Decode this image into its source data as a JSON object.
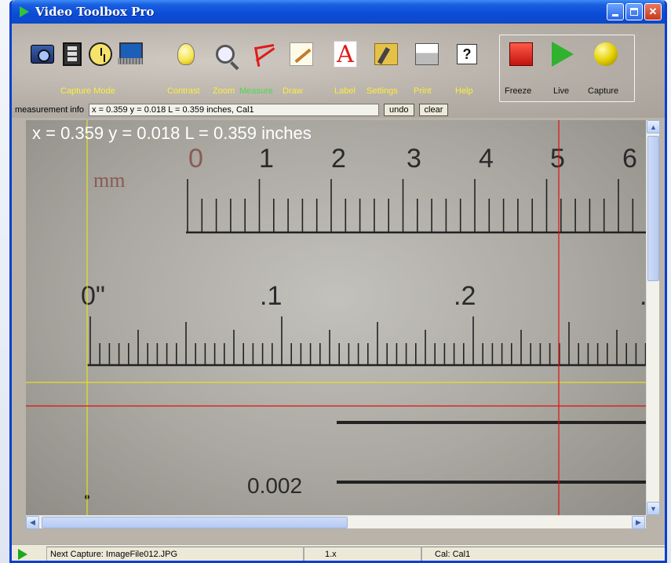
{
  "window": {
    "title": "Video Toolbox Pro"
  },
  "toolbar": {
    "capture_mode_label": "Capture Mode",
    "contrast_label": "Contrast",
    "zoom_label": "Zoom",
    "measure_label": "Measure",
    "draw_label": "Draw",
    "label_label": "Label",
    "settings_label": "Settings",
    "print_label": "Print",
    "help_label": "Help",
    "freeze_label": "Freeze",
    "live_label": "Live",
    "capture_label": "Capture"
  },
  "measurement": {
    "info_label": "measurement info",
    "info_value": "x = 0.359 y = 0.018 L = 0.359 inches, Cal1",
    "undo_label": "undo",
    "clear_label": "clear"
  },
  "image": {
    "overlay_readout": "x = 0.359 y = 0.018 L = 0.359 inches",
    "mm_text": "mm",
    "mm_numbers": [
      "0",
      "1",
      "2",
      "3",
      "4",
      "5",
      "6"
    ],
    "inch_numbers": [
      "0\"",
      ".1",
      ".2",
      "."
    ],
    "wire_label": "0.002"
  },
  "statusbar": {
    "next_capture": "Next Capture: ImageFile012.JPG",
    "zoom_value": "1.x",
    "calibration": "Cal: Cal1"
  },
  "colors": {
    "titlebar": "#0b4cd7",
    "tool_label": "#ffec3a",
    "measure_label": "#4ed84e",
    "crosshair_red": "#e01010",
    "crosshair_yellow": "#e8e020"
  }
}
